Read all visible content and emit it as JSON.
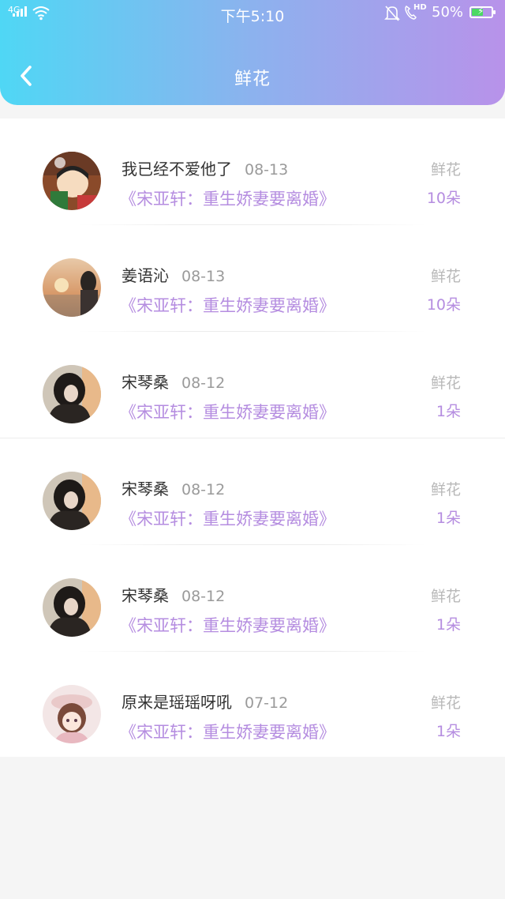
{
  "status_bar": {
    "network": "4G",
    "time": "下午5:10",
    "hd": "HD",
    "battery": "50%",
    "battery_level": 0.5
  },
  "header": {
    "title": "鲜花"
  },
  "colors": {
    "header_gradient": [
      "#4fd7f5",
      "#b892ea"
    ],
    "accent": "#b58de0"
  },
  "records": [
    {
      "name": "我已经不爱他了",
      "date": "08-13",
      "book": "《宋亚轩：重生娇妻要离婚》",
      "kind": "鲜花",
      "count": "10朵",
      "avatar": "avatar-cartoon"
    },
    {
      "name": "姜语沁",
      "date": "08-13",
      "book": "《宋亚轩：重生娇妻要离婚》",
      "kind": "鲜花",
      "count": "10朵",
      "avatar": "avatar-sunset"
    },
    {
      "name": "宋琴桑",
      "date": "08-12",
      "book": "《宋亚轩：重生娇妻要离婚》",
      "kind": "鲜花",
      "count": "1朵",
      "avatar": "avatar-girl-dark-hair"
    },
    {
      "name": "宋琴桑",
      "date": "08-12",
      "book": "《宋亚轩：重生娇妻要离婚》",
      "kind": "鲜花",
      "count": "1朵",
      "avatar": "avatar-girl-dark-hair"
    },
    {
      "name": "宋琴桑",
      "date": "08-12",
      "book": "《宋亚轩：重生娇妻要离婚》",
      "kind": "鲜花",
      "count": "1朵",
      "avatar": "avatar-girl-dark-hair"
    },
    {
      "name": "原来是瑶瑶呀吼",
      "date": "07-12",
      "book": "《宋亚轩：重生娇妻要离婚》",
      "kind": "鲜花",
      "count": "1朵",
      "avatar": "avatar-anime-girl"
    }
  ]
}
